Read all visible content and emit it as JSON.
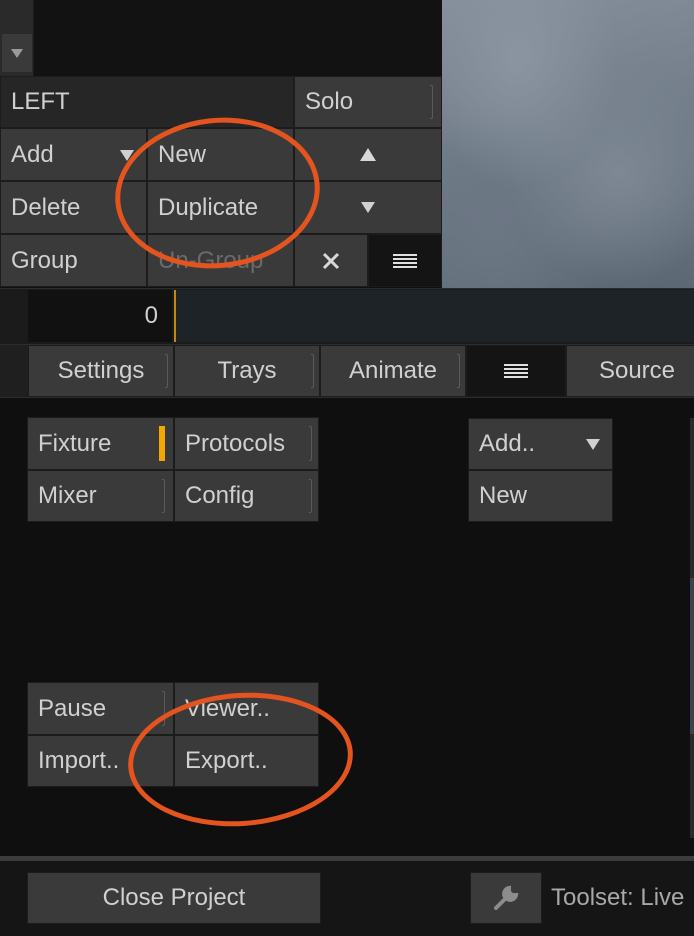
{
  "track": {
    "name": "LEFT",
    "solo_label": "Solo"
  },
  "layer_buttons": {
    "add": "Add",
    "new": "New",
    "delete": "Delete",
    "duplicate": "Duplicate",
    "group": "Group",
    "ungroup": "Un-Group"
  },
  "timeline": {
    "value": "0"
  },
  "tabs": [
    {
      "label": "Settings"
    },
    {
      "label": "Trays"
    },
    {
      "label": "Animate"
    },
    {
      "label": "Source"
    }
  ],
  "settings_buttons": {
    "fixture": "Fixture",
    "protocols": "Protocols",
    "mixer": "Mixer",
    "config": "Config",
    "pause": "Pause",
    "viewer": "Viewer..",
    "import": "Import..",
    "export": "Export..",
    "add_menu": "Add..",
    "new": "New"
  },
  "footer": {
    "close_project": "Close Project",
    "toolset": "Toolset: Live"
  },
  "colors": {
    "accent": "#f2a800",
    "annotation": "#e3541f"
  }
}
